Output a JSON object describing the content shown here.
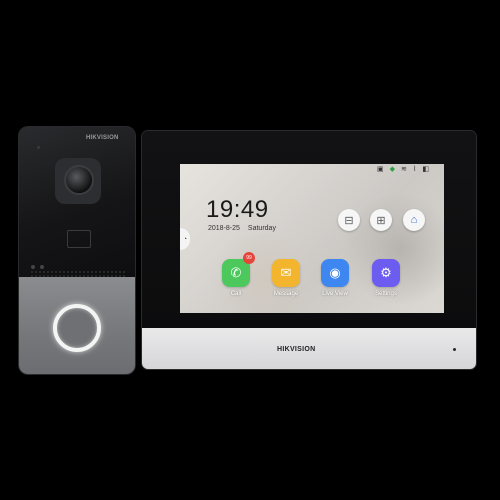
{
  "door_station": {
    "brand": "HIKVISION"
  },
  "monitor": {
    "brand": "HIKVISION",
    "screen": {
      "time": "19:49",
      "date": "2018-8-25",
      "weekday": "Saturday",
      "status_icons": [
        "sd-card-icon",
        "shield-icon",
        "wifi-icon",
        "wired-network-icon",
        "volume-icon"
      ],
      "quick_buttons": [
        "elevator-icon",
        "building-icon",
        "home-icon"
      ],
      "apps": [
        {
          "label": "Call",
          "color": "#4cc85d",
          "icon": "phone-icon",
          "badge": "99"
        },
        {
          "label": "Message",
          "color": "#f2b52d",
          "icon": "message-icon"
        },
        {
          "label": "Live View",
          "color": "#3e86f0",
          "icon": "camera-icon"
        },
        {
          "label": "Settings",
          "color": "#6d5cf0",
          "icon": "gear-icon"
        }
      ]
    }
  }
}
